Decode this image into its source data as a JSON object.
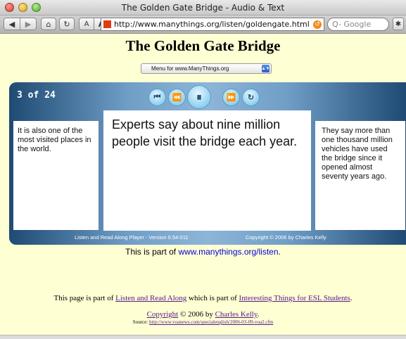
{
  "window": {
    "title": "The Golden Gate Bridge - Audio & Text"
  },
  "toolbar": {
    "back_glyph": "◀",
    "forward_glyph": "▶",
    "home_glyph": "⌂",
    "reload_glyph": "↻",
    "text_smaller": "A",
    "text_bigger": "A",
    "url": "http://www.manythings.org/listen/goldengate.html",
    "search_placeholder": "Q- Google",
    "bug_glyph": "✱"
  },
  "page": {
    "title": "The Golden Gate Bridge",
    "menu_select_value": "Menu for www.ManyThings.org"
  },
  "player": {
    "counter": "3 of 24",
    "controls": {
      "first": "⏮",
      "rewind": "⏪",
      "pause": "⏸",
      "fast_forward": "⏩",
      "repeat": "↻"
    },
    "prev_text": "It is also one of the most visited places in the world.",
    "current_text": "Experts say about nine million people visit the bridge each year.",
    "next_text": "They say more than one thousand million vehicles have used the bridge since it opened almost seventy years ago.",
    "version": "Listen and Read Along Player - Version 0.54-011",
    "copyright": "Copyright © 2006 by Charles Kelly"
  },
  "part_line": {
    "prefix": "This is part of ",
    "link": "www.manythings.org/listen",
    "suffix": "."
  },
  "footer": {
    "part_prefix": "This page is part of ",
    "listen_link": "Listen and Read Along",
    "part_middle": " which is part of ",
    "esl_link": "Interesting Things for ESL Students",
    "part_suffix": ".",
    "copyright_link": "Copyright",
    "copyright_middle": " © 2006 by ",
    "author_link": "Charles Kelly",
    "copyright_suffix": ".",
    "source_prefix": "Source: ",
    "source_link": "http://www.voanews.com/specialenglish/2006-03-09-voa2.cfm"
  }
}
